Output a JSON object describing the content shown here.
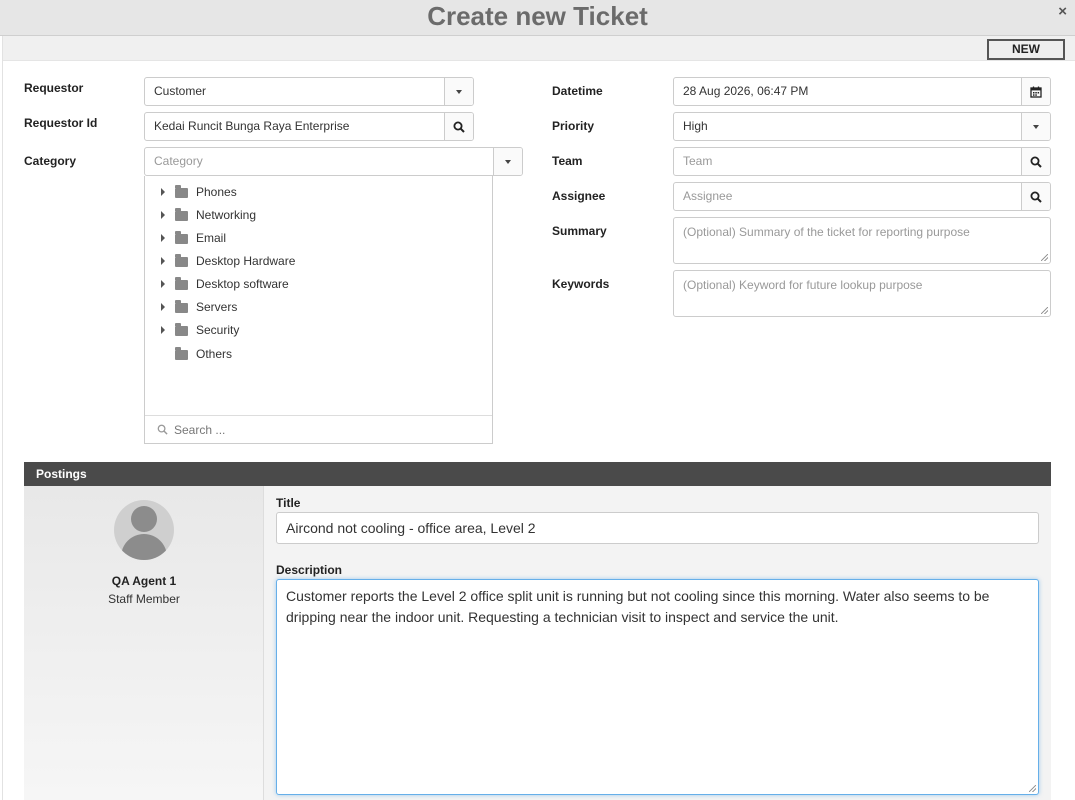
{
  "dialog": {
    "title": "Create new Ticket",
    "close_label": "×"
  },
  "toolbar": {
    "new_label": "NEW"
  },
  "form": {
    "requestor": {
      "label": "Requestor",
      "value": "Customer"
    },
    "requestor_id": {
      "label": "Requestor Id",
      "value": "Kedai Runcit Bunga Raya Enterprise"
    },
    "category": {
      "label": "Category",
      "placeholder": "Category"
    },
    "datetime": {
      "label": "Datetime",
      "value": "28 Aug 2026, 06:47 PM"
    },
    "priority": {
      "label": "Priority",
      "value": "High"
    },
    "team": {
      "label": "Team",
      "placeholder": "Team"
    },
    "assignee": {
      "label": "Assignee",
      "placeholder": "Assignee"
    },
    "summary": {
      "label": "Summary",
      "placeholder": "(Optional) Summary of the ticket for reporting purpose"
    },
    "keywords": {
      "label": "Keywords",
      "placeholder": "(Optional) Keyword for future lookup purpose"
    }
  },
  "category_tree": {
    "items": [
      {
        "label": "Phones",
        "expandable": true
      },
      {
        "label": "Networking",
        "expandable": true
      },
      {
        "label": "Email",
        "expandable": true
      },
      {
        "label": "Desktop Hardware",
        "expandable": true
      },
      {
        "label": "Desktop software",
        "expandable": true
      },
      {
        "label": "Servers",
        "expandable": true
      },
      {
        "label": "Security",
        "expandable": true
      },
      {
        "label": "Others",
        "expandable": false
      }
    ],
    "search_placeholder": "Search ..."
  },
  "postings": {
    "header": "Postings",
    "agent": {
      "name": "QA Agent 1",
      "role": "Staff Member"
    },
    "title_label": "Title",
    "title_value": "Aircond not cooling - office area, Level 2",
    "description_label": "Description",
    "description_value": "Customer reports the Level 2 office split unit is running but not cooling since this morning. Water also seems to be dripping near the indoor unit. Requesting a technician visit to inspect and service the unit."
  },
  "icons": {
    "dropdown": "caret-down-icon",
    "search": "magnifier-icon",
    "calendar": "calendar-icon",
    "folder": "folder-icon",
    "expand": "caret-right-icon",
    "close": "close-icon"
  }
}
